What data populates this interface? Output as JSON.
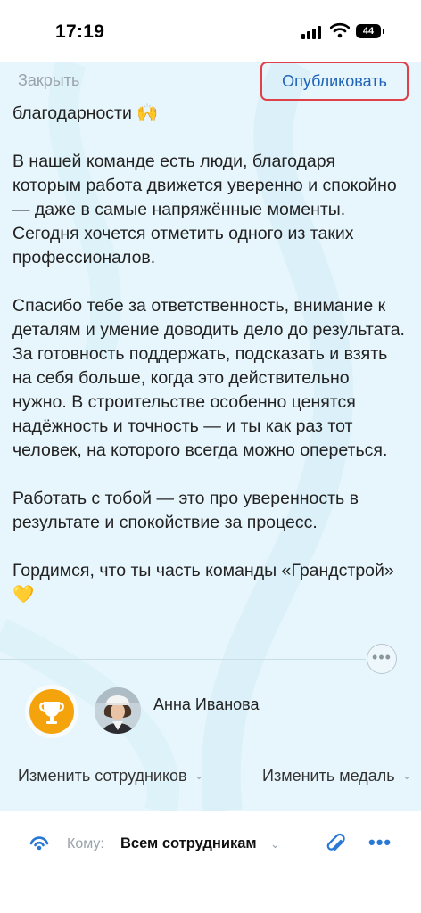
{
  "status_bar": {
    "time": "17:19",
    "battery": "44"
  },
  "nav": {
    "close_label": "Закрыть",
    "publish_label": "Опубликовать"
  },
  "message": {
    "paragraphs": [
      "благодарности 🙌",
      "В нашей команде есть люди, благодаря которым работа движется уверенно и спокойно — даже в самые напряжённые моменты. Сегодня хочется отметить одного из таких профессионалов.",
      "Спасибо тебе за ответственность, внимание к деталям и умение доводить дело до результата. За готовность поддержать, подсказать и взять на себя больше, когда это действительно нужно. В строительстве особенно ценятся надёжность и точность — и ты как раз тот человек, на которого всегда можно опереться.",
      "Работать с тобой — это про уверенность в результате и спокойствие за процесс.",
      "Гордимся, что ты часть команды «Грандстрой» 💛"
    ]
  },
  "recipient": {
    "name": "Анна Иванова"
  },
  "actions": {
    "change_employees": "Изменить сотрудников",
    "change_medal": "Изменить медаль"
  },
  "bottom": {
    "to_label": "Кому:",
    "to_value": "Всем сотрудникам"
  },
  "icons": {
    "signal": "cellular-signal-icon",
    "wifi": "wifi-icon",
    "battery": "battery-icon",
    "more": "more-horizontal-icon",
    "medal": "trophy-icon",
    "broadcast": "broadcast-icon",
    "attach": "paperclip-icon",
    "overflow": "more-dots-icon",
    "chevron": "chevron-down-icon"
  },
  "colors": {
    "accent": "#1e63b8",
    "highlight_border": "#e0404a",
    "medal": "#f5a30d",
    "background": "#e7f6fc"
  }
}
